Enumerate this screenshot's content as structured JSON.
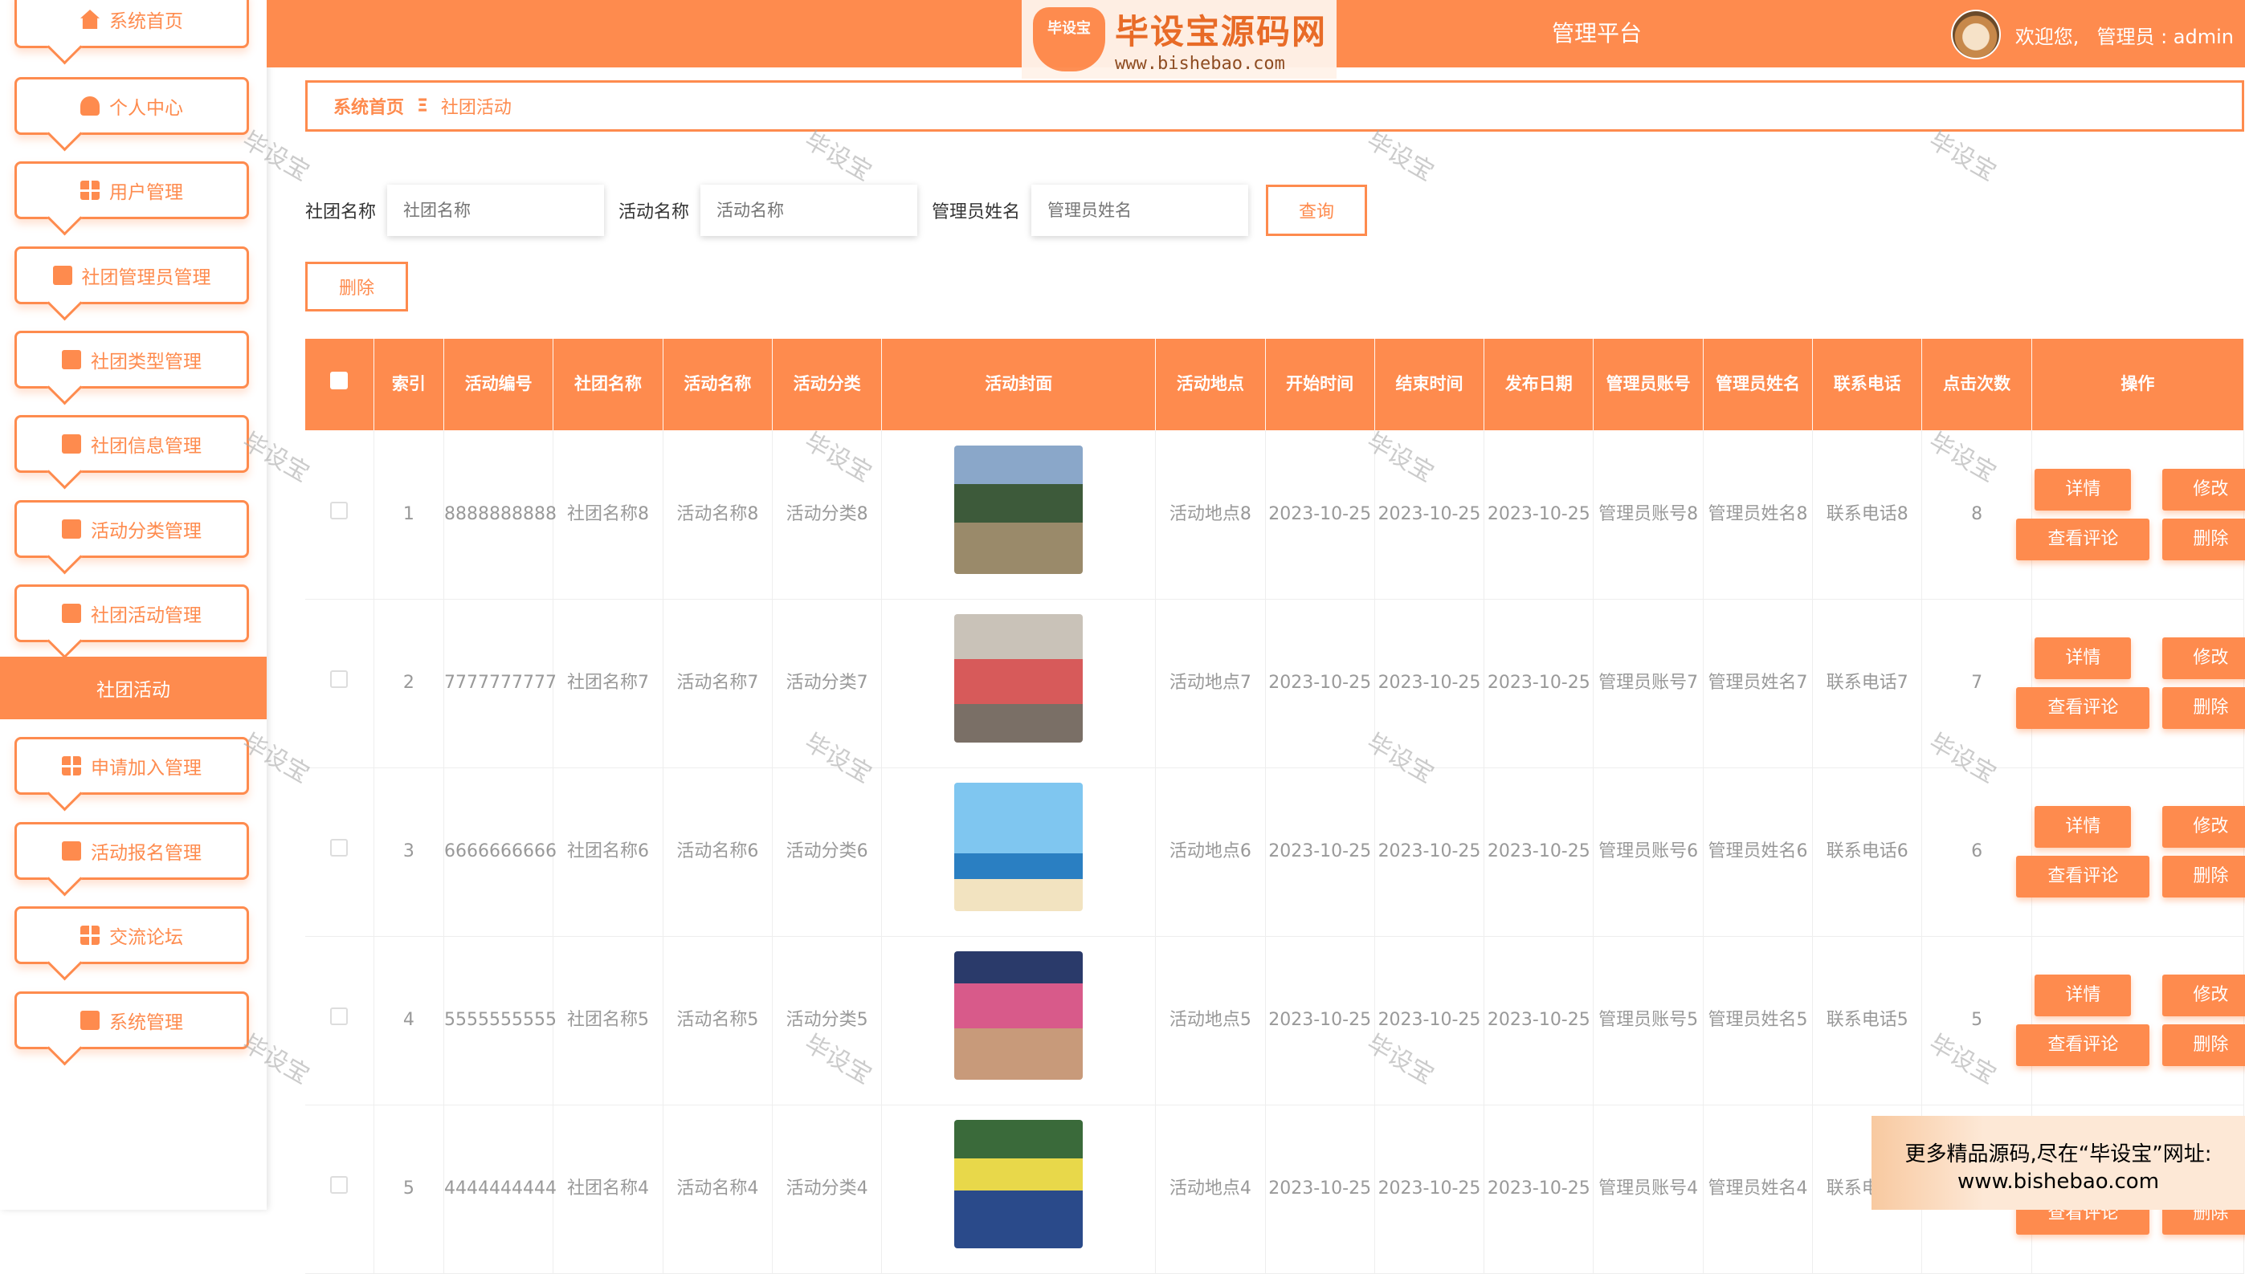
{
  "sidebar": {
    "items": [
      {
        "label": "系统首页",
        "icon": "home-icon"
      },
      {
        "label": "个人中心",
        "icon": "person-icon"
      },
      {
        "label": "用户管理",
        "icon": "grid-icon"
      },
      {
        "label": "社团管理员管理",
        "icon": "wallet-icon"
      },
      {
        "label": "社团类型管理",
        "icon": "chart-icon"
      },
      {
        "label": "社团信息管理",
        "icon": "monitor-icon"
      },
      {
        "label": "活动分类管理",
        "icon": "briefcase-icon"
      },
      {
        "label": "社团活动管理",
        "icon": "monitor-icon"
      }
    ],
    "active_sub": "社团活动",
    "items_after": [
      {
        "label": "申请加入管理",
        "icon": "grid-icon"
      },
      {
        "label": "活动报名管理",
        "icon": "chat-icon"
      },
      {
        "label": "交流论坛",
        "icon": "grid-icon"
      },
      {
        "label": "系统管理",
        "icon": "tools-icon"
      }
    ]
  },
  "header": {
    "logo_badge": "毕设宝",
    "logo_text": "毕设宝源码网",
    "logo_url": "www.bishebao.com",
    "platform_title": "管理平台",
    "welcome": "欢迎您,",
    "user": "管理员 : admin",
    "accent": "#fe8b4e"
  },
  "breadcrumb": {
    "home": "系统首页",
    "sep": "Ξ",
    "current": "社团活动"
  },
  "search": {
    "club_label": "社团名称",
    "club_placeholder": "社团名称",
    "activity_label": "活动名称",
    "activity_placeholder": "活动名称",
    "admin_label": "管理员姓名",
    "admin_placeholder": "管理员姓名",
    "query": "查询"
  },
  "delete_label": "删除",
  "table": {
    "headers": [
      "索引",
      "活动编号",
      "社团名称",
      "活动名称",
      "活动分类",
      "活动封面",
      "活动地点",
      "开始时间",
      "结束时间",
      "发布日期",
      "管理员账号",
      "管理员姓名",
      "联系电话",
      "点击次数",
      "操作"
    ],
    "ops": {
      "detail": "详情",
      "edit": "修改",
      "comments": "查看评论",
      "delete": "删除"
    },
    "rows": [
      {
        "index": "1",
        "code": "8888888888",
        "club": "社团名称8",
        "activity": "活动名称8",
        "category": "活动分类8",
        "place": "活动地点8",
        "start": "2023-10-25",
        "end": "2023-10-25",
        "publish": "2023-10-25",
        "account": "管理员账号8",
        "name": "管理员姓名8",
        "phone": "联系电话8",
        "clicks": "8"
      },
      {
        "index": "2",
        "code": "7777777777",
        "club": "社团名称7",
        "activity": "活动名称7",
        "category": "活动分类7",
        "place": "活动地点7",
        "start": "2023-10-25",
        "end": "2023-10-25",
        "publish": "2023-10-25",
        "account": "管理员账号7",
        "name": "管理员姓名7",
        "phone": "联系电话7",
        "clicks": "7"
      },
      {
        "index": "3",
        "code": "6666666666",
        "club": "社团名称6",
        "activity": "活动名称6",
        "category": "活动分类6",
        "place": "活动地点6",
        "start": "2023-10-25",
        "end": "2023-10-25",
        "publish": "2023-10-25",
        "account": "管理员账号6",
        "name": "管理员姓名6",
        "phone": "联系电话6",
        "clicks": "6"
      },
      {
        "index": "4",
        "code": "5555555555",
        "club": "社团名称5",
        "activity": "活动名称5",
        "category": "活动分类5",
        "place": "活动地点5",
        "start": "2023-10-25",
        "end": "2023-10-25",
        "publish": "2023-10-25",
        "account": "管理员账号5",
        "name": "管理员姓名5",
        "phone": "联系电话5",
        "clicks": "5"
      },
      {
        "index": "5",
        "code": "4444444444",
        "club": "社团名称4",
        "activity": "活动名称4",
        "category": "活动分类4",
        "place": "活动地点4",
        "start": "2023-10-25",
        "end": "2023-10-25",
        "publish": "2023-10-25",
        "account": "管理员账号4",
        "name": "管理员姓名4",
        "phone": "联系电话4",
        "clicks": ""
      }
    ]
  },
  "watermark": "毕设宝",
  "promo": {
    "line1": "更多精品源码,尽在“毕设宝”网址:",
    "line2": "www.bishebao.com"
  }
}
